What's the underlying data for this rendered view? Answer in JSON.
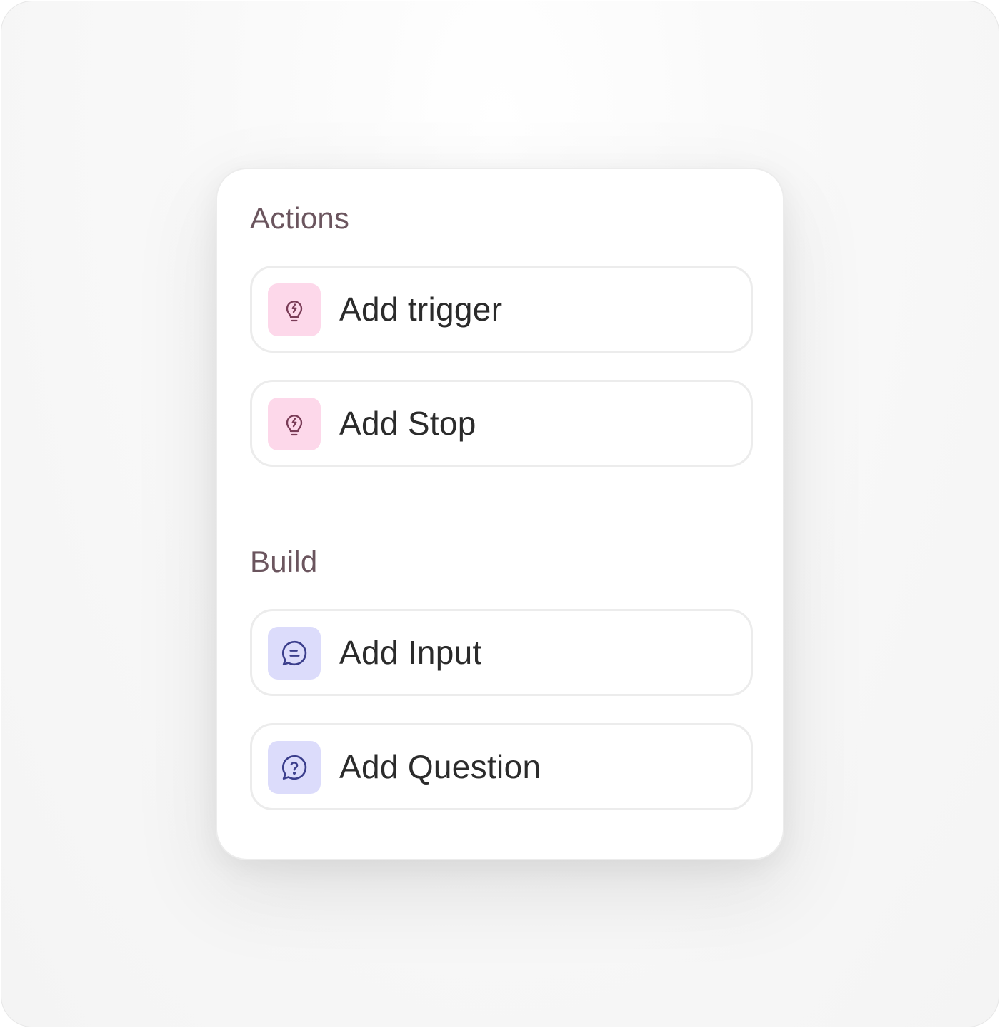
{
  "sections": [
    {
      "title": "Actions",
      "items": [
        {
          "label": "Add trigger",
          "icon": "lightbulb-bolt-icon",
          "icon_bg": "#fdd8ea"
        },
        {
          "label": "Add Stop",
          "icon": "lightbulb-bolt-icon",
          "icon_bg": "#fdd8ea"
        }
      ]
    },
    {
      "title": "Build",
      "items": [
        {
          "label": "Add Input",
          "icon": "chat-bubble-icon",
          "icon_bg": "#dcdcfb"
        },
        {
          "label": "Add Question",
          "icon": "question-bubble-icon",
          "icon_bg": "#dcdcfb"
        }
      ]
    }
  ],
  "colors": {
    "pink_icon": "#7a3c57",
    "lilac_icon": "#3b3e8c",
    "section_title": "#6b555e",
    "label": "#2b2b2b"
  }
}
